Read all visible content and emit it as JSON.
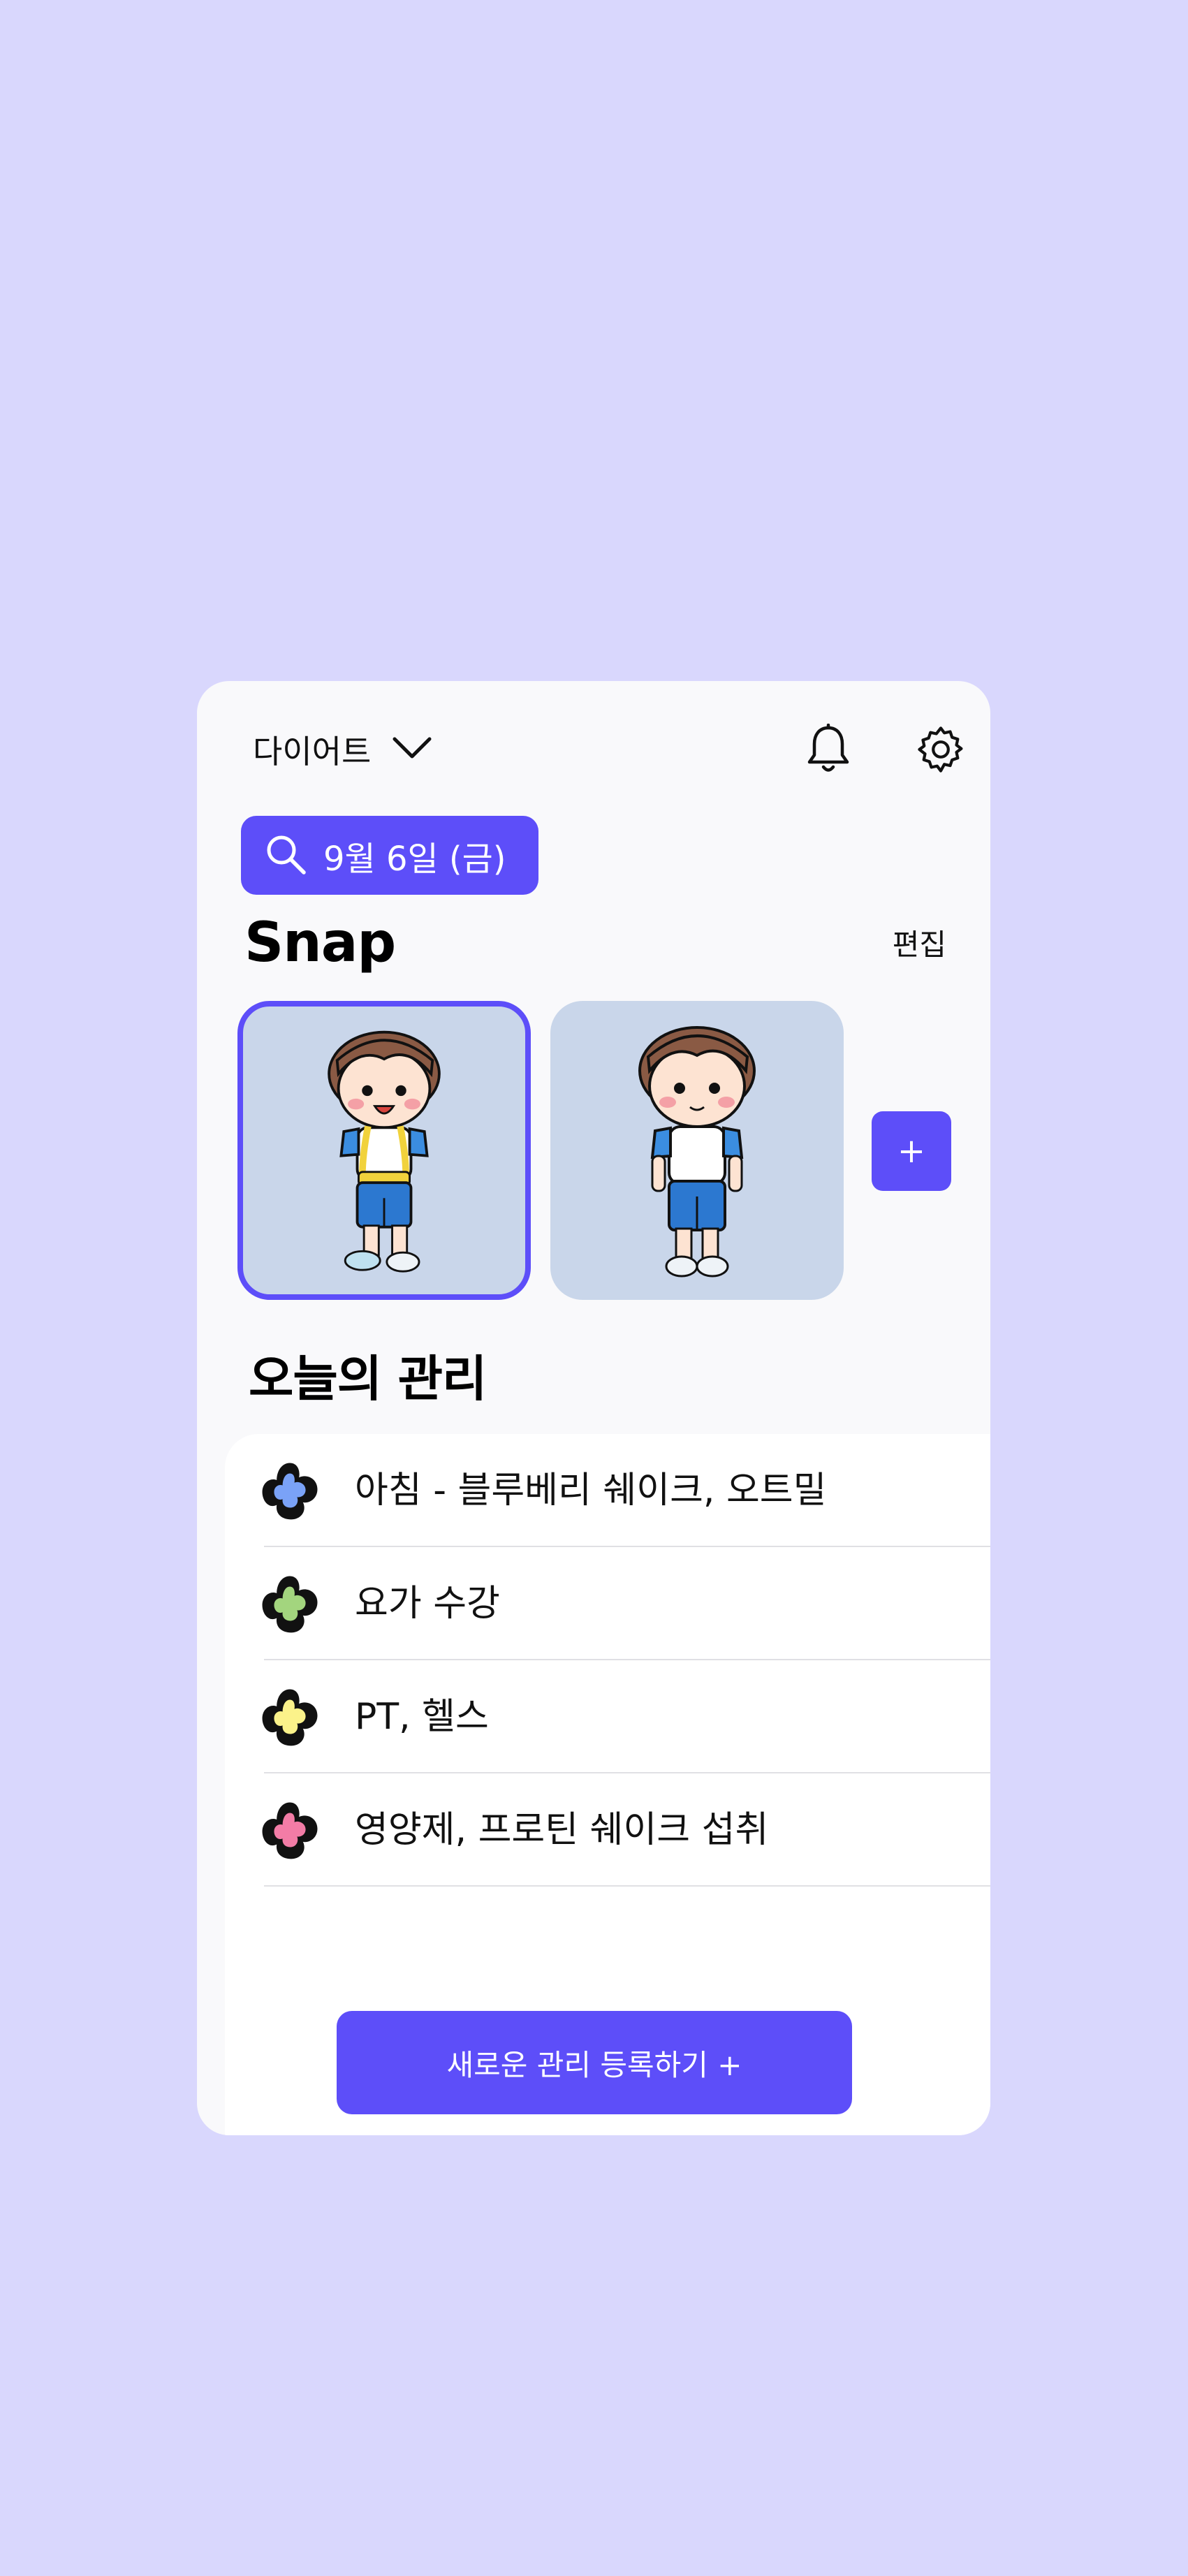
{
  "header": {
    "category_label": "다이어트",
    "icons": [
      "chevron-down-icon",
      "bell-icon",
      "gear-icon"
    ]
  },
  "date_filter": {
    "label": "9월 6일 (금)"
  },
  "snap": {
    "title": "Snap",
    "edit_label": "편집",
    "add_label": "+",
    "photos": [
      {
        "selected": true
      },
      {
        "selected": false
      }
    ]
  },
  "today": {
    "title": "오늘의 관리",
    "items": [
      {
        "label": "아침 - 블루베리 쉐이크, 오트밀",
        "color": "#7aa2f7"
      },
      {
        "label": "요가 수강",
        "color": "#a3d57e"
      },
      {
        "label": "PT, 헬스",
        "color": "#fbf28a"
      },
      {
        "label": "영양제, 프로틴 쉐이크 섭취",
        "color": "#f37ca6"
      }
    ],
    "register_label": "새로운 관리 등록하기 +"
  },
  "colors": {
    "background": "#d9d7fd",
    "accent": "#5d4ef9",
    "card": "#f9f9fb",
    "snap_bg": "#c9d6ea"
  }
}
